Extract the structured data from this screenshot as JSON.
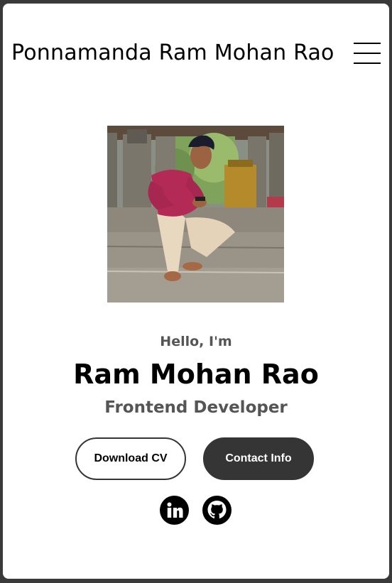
{
  "nav": {
    "logo_text": "Ponnamanda Ram Mohan Rao",
    "menu_icon": "hamburger-menu-icon"
  },
  "profile": {
    "image": "profile-photo"
  },
  "hero": {
    "greeting": "Hello, I'm",
    "name": "Ram Mohan Rao",
    "title": "Frontend Developer"
  },
  "buttons": {
    "download_cv": "Download CV",
    "contact_info": "Contact Info"
  },
  "social": [
    {
      "icon": "linkedin-icon"
    },
    {
      "icon": "github-icon"
    }
  ],
  "colors": {
    "text_primary": "#000000",
    "text_secondary": "#555555",
    "button_dark": "#353535",
    "background": "#ffffff"
  }
}
